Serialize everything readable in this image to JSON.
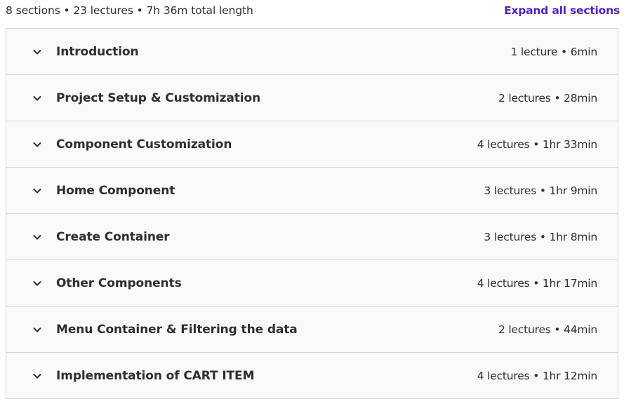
{
  "header": {
    "summary": "8 sections • 23 lectures • 7h 36m total length",
    "expand_label": "Expand all sections"
  },
  "sections": [
    {
      "title": "Introduction",
      "meta": "1 lecture • 6min"
    },
    {
      "title": "Project Setup & Customization",
      "meta": "2 lectures • 28min"
    },
    {
      "title": "Component Customization",
      "meta": "4 lectures • 1hr 33min"
    },
    {
      "title": "Home Component",
      "meta": "3 lectures • 1hr 9min"
    },
    {
      "title": "Create Container",
      "meta": "3 lectures • 1hr 8min"
    },
    {
      "title": "Other Components",
      "meta": "4 lectures • 1hr 17min"
    },
    {
      "title": "Menu Container & Filtering the data",
      "meta": "2 lectures • 44min"
    },
    {
      "title": "Implementation of CART ITEM",
      "meta": "4 lectures • 1hr 12min"
    }
  ],
  "icons": {
    "chevron": "chevron-down-icon"
  },
  "colors": {
    "accent": "#5022c3",
    "text": "#2d2f31",
    "section_bg": "#f7f9fa",
    "border": "#d1d7dc"
  }
}
